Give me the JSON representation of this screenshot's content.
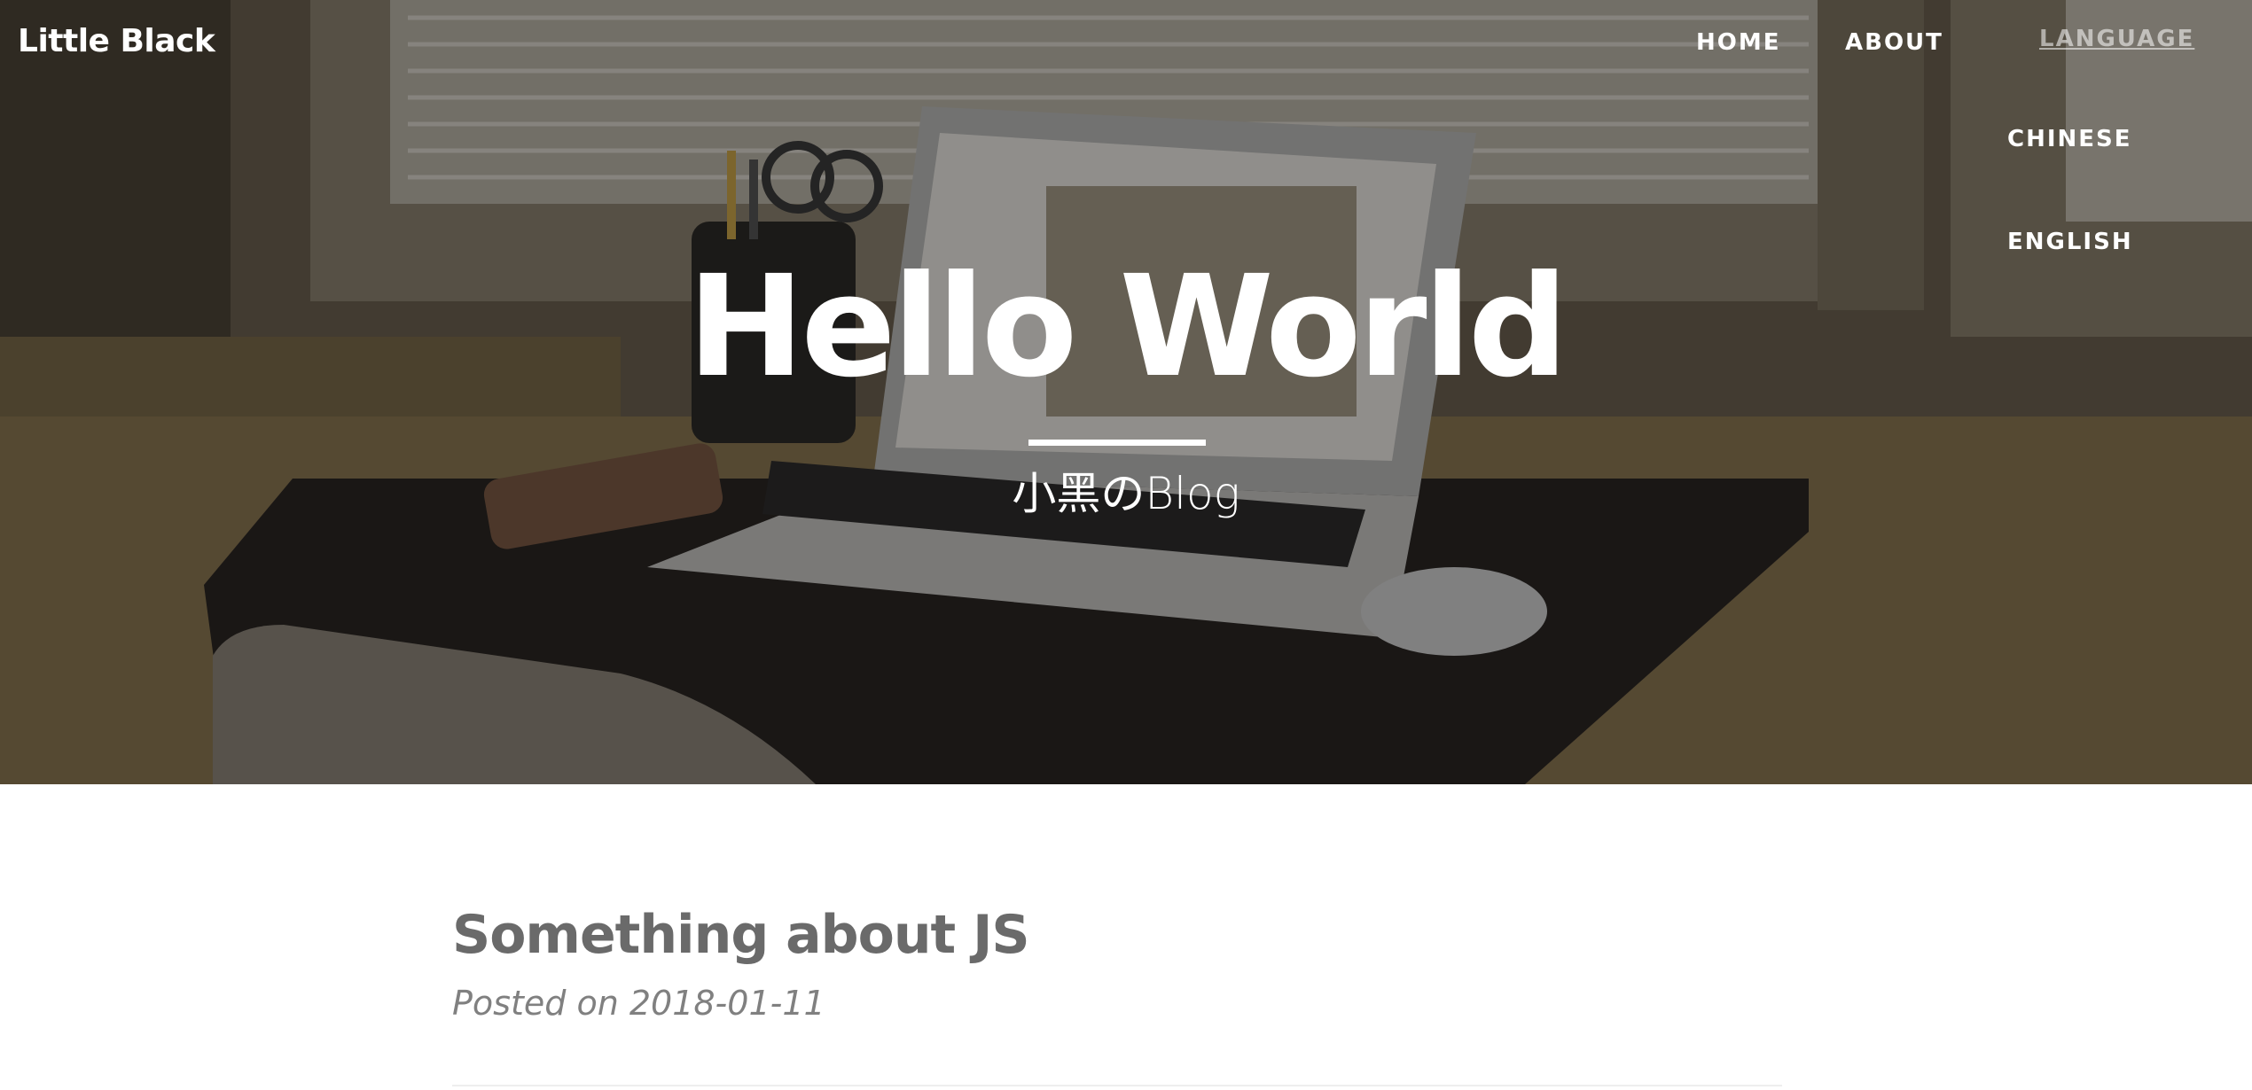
{
  "nav": {
    "brand": "Little Black",
    "home": "HOME",
    "about": "ABOUT",
    "language": "LANGUAGE",
    "language_options": [
      "CHINESE",
      "ENGLISH"
    ]
  },
  "hero": {
    "title": "Hello World",
    "subtitle": "小黑のBlog"
  },
  "posts": [
    {
      "title": "Something about JS",
      "meta": "Posted on 2018-01-11"
    }
  ]
}
